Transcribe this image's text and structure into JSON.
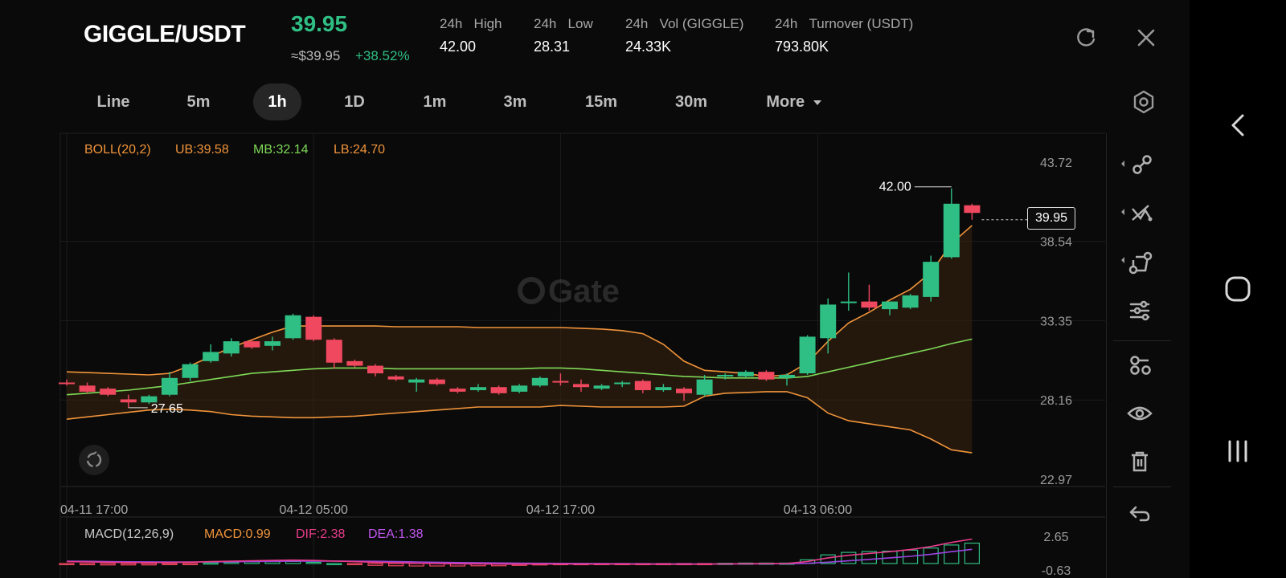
{
  "header": {
    "pair": "GIGGLE/USDT",
    "price": "39.95",
    "approx_usd": "≈$39.95",
    "change_pct": "+38.52%",
    "stats": [
      {
        "label_prefix": "24h",
        "label": "High",
        "value": "42.00"
      },
      {
        "label_prefix": "24h",
        "label": "Low",
        "value": "28.31"
      },
      {
        "label_prefix": "24h",
        "label": "Vol (GIGGLE)",
        "value": "24.33K"
      },
      {
        "label_prefix": "24h",
        "label": "Turnover (USDT)",
        "value": "793.80K"
      }
    ],
    "icons": [
      "refresh-icon",
      "close-icon"
    ]
  },
  "tabs": [
    {
      "label": "Line",
      "active": false
    },
    {
      "label": "5m",
      "active": false
    },
    {
      "label": "1h",
      "active": true
    },
    {
      "label": "1D",
      "active": false
    },
    {
      "label": "1m",
      "active": false
    },
    {
      "label": "3m",
      "active": false
    },
    {
      "label": "15m",
      "active": false
    },
    {
      "label": "30m",
      "active": false
    },
    {
      "label": "More",
      "active": false,
      "dropdown": true
    }
  ],
  "boll_legend": {
    "name": "BOLL(20,2)",
    "ub": "UB:39.58",
    "mb": "MB:32.14",
    "lb": "LB:24.70"
  },
  "macd_legend": {
    "name": "MACD(12,26,9)",
    "macd": "MACD:0.99",
    "dif": "DIF:2.38",
    "dea": "DEA:1.38"
  },
  "watermark": "Gate",
  "high_marker": "42.00",
  "low_marker": "27.65",
  "last_price_box": "39.95",
  "colors": {
    "up": "#2fbf84",
    "down": "#f0485f",
    "ub": "#f0943a",
    "mb": "#7ed957",
    "dif": "#e83c8c",
    "dea": "#9a45e0"
  },
  "sidebar_icons": [
    "trend-line-icon",
    "multi-line-icon",
    "shape-icon",
    "settings-sliders-icon",
    "indicators-icon",
    "eye-icon",
    "trash-icon",
    "undo-icon"
  ],
  "nav_icons": [
    "back-icon",
    "home-icon",
    "recents-icon"
  ],
  "chart_data": {
    "type": "candlestick",
    "price_axis_ticks": [
      "43.72",
      "38.54",
      "33.35",
      "28.16",
      "22.97"
    ],
    "price_range": [
      22.97,
      43.72
    ],
    "time_labels": [
      "04-11 17:00",
      "04-12 05:00",
      "04-12 17:00",
      "04-13 06:00"
    ],
    "time_label_candle_index": [
      0,
      12,
      24,
      36.5
    ],
    "candles": [
      {
        "o": 29.3,
        "h": 29.5,
        "l": 29.1,
        "c": 29.2
      },
      {
        "o": 29.1,
        "h": 29.3,
        "l": 28.6,
        "c": 28.7
      },
      {
        "o": 28.9,
        "h": 29.0,
        "l": 28.4,
        "c": 28.5
      },
      {
        "o": 28.2,
        "h": 28.5,
        "l": 27.65,
        "c": 28.0
      },
      {
        "o": 28.0,
        "h": 28.5,
        "l": 27.9,
        "c": 28.4
      },
      {
        "o": 28.5,
        "h": 30.0,
        "l": 28.4,
        "c": 29.6
      },
      {
        "o": 29.6,
        "h": 30.6,
        "l": 29.4,
        "c": 30.5
      },
      {
        "o": 30.7,
        "h": 31.8,
        "l": 30.6,
        "c": 31.3
      },
      {
        "o": 31.2,
        "h": 32.2,
        "l": 31.0,
        "c": 32.0
      },
      {
        "o": 32.0,
        "h": 32.1,
        "l": 31.5,
        "c": 31.6
      },
      {
        "o": 31.7,
        "h": 32.3,
        "l": 31.4,
        "c": 32.0
      },
      {
        "o": 32.2,
        "h": 33.8,
        "l": 32.1,
        "c": 33.7
      },
      {
        "o": 33.6,
        "h": 33.7,
        "l": 32.0,
        "c": 32.1
      },
      {
        "o": 32.1,
        "h": 32.2,
        "l": 30.2,
        "c": 30.6
      },
      {
        "o": 30.7,
        "h": 30.8,
        "l": 30.3,
        "c": 30.4
      },
      {
        "o": 30.4,
        "h": 30.5,
        "l": 29.7,
        "c": 29.9
      },
      {
        "o": 29.7,
        "h": 29.8,
        "l": 29.4,
        "c": 29.5
      },
      {
        "o": 29.3,
        "h": 29.6,
        "l": 28.7,
        "c": 29.5
      },
      {
        "o": 29.5,
        "h": 29.6,
        "l": 29.1,
        "c": 29.2
      },
      {
        "o": 28.9,
        "h": 29.0,
        "l": 28.6,
        "c": 28.7
      },
      {
        "o": 28.8,
        "h": 29.2,
        "l": 28.7,
        "c": 29.0
      },
      {
        "o": 29.0,
        "h": 29.1,
        "l": 28.5,
        "c": 28.6
      },
      {
        "o": 28.7,
        "h": 29.2,
        "l": 28.6,
        "c": 29.1
      },
      {
        "o": 29.1,
        "h": 29.7,
        "l": 29.0,
        "c": 29.6
      },
      {
        "o": 29.4,
        "h": 29.9,
        "l": 29.1,
        "c": 29.3
      },
      {
        "o": 29.2,
        "h": 29.5,
        "l": 28.7,
        "c": 29.0
      },
      {
        "o": 28.9,
        "h": 29.2,
        "l": 28.8,
        "c": 29.1
      },
      {
        "o": 29.2,
        "h": 29.4,
        "l": 29.0,
        "c": 29.3
      },
      {
        "o": 29.4,
        "h": 29.5,
        "l": 28.6,
        "c": 28.8
      },
      {
        "o": 28.8,
        "h": 29.2,
        "l": 28.7,
        "c": 29.0
      },
      {
        "o": 28.9,
        "h": 29.0,
        "l": 28.1,
        "c": 28.6
      },
      {
        "o": 28.5,
        "h": 29.8,
        "l": 28.4,
        "c": 29.5
      },
      {
        "o": 29.7,
        "h": 29.9,
        "l": 29.5,
        "c": 29.8
      },
      {
        "o": 29.7,
        "h": 30.1,
        "l": 29.6,
        "c": 30.0
      },
      {
        "o": 30.0,
        "h": 30.1,
        "l": 29.4,
        "c": 29.5
      },
      {
        "o": 29.6,
        "h": 29.9,
        "l": 29.1,
        "c": 29.8
      },
      {
        "o": 29.9,
        "h": 32.4,
        "l": 29.8,
        "c": 32.3
      },
      {
        "o": 32.2,
        "h": 34.8,
        "l": 31.2,
        "c": 34.4
      },
      {
        "o": 34.5,
        "h": 36.5,
        "l": 34.0,
        "c": 34.6
      },
      {
        "o": 34.6,
        "h": 35.7,
        "l": 34.0,
        "c": 34.2
      },
      {
        "o": 34.1,
        "h": 34.6,
        "l": 33.7,
        "c": 34.6
      },
      {
        "o": 34.2,
        "h": 35.1,
        "l": 34.1,
        "c": 35.0
      },
      {
        "o": 34.9,
        "h": 37.6,
        "l": 34.6,
        "c": 37.2
      },
      {
        "o": 37.5,
        "h": 42.0,
        "l": 37.4,
        "c": 41.0
      },
      {
        "o": 40.9,
        "h": 41.0,
        "l": 39.95,
        "c": 40.4
      }
    ],
    "boll_ub": [
      30.0,
      29.95,
      29.9,
      29.85,
      29.8,
      29.9,
      30.4,
      31.0,
      31.6,
      32.1,
      32.6,
      33.0,
      33.0,
      33.0,
      33.0,
      33.0,
      32.95,
      32.95,
      32.95,
      32.95,
      32.9,
      32.9,
      32.9,
      32.9,
      32.9,
      32.85,
      32.8,
      32.7,
      32.5,
      31.8,
      30.7,
      30.1,
      30.0,
      29.9,
      29.7,
      29.8,
      30.6,
      32.0,
      33.2,
      33.9,
      34.7,
      35.4,
      36.5,
      38.4,
      39.58
    ],
    "boll_mb": [
      28.5,
      28.6,
      28.7,
      28.8,
      28.95,
      29.1,
      29.3,
      29.5,
      29.7,
      29.9,
      30.0,
      30.1,
      30.2,
      30.25,
      30.25,
      30.25,
      30.2,
      30.2,
      30.2,
      30.2,
      30.2,
      30.2,
      30.2,
      30.25,
      30.25,
      30.2,
      30.1,
      30.0,
      29.9,
      29.8,
      29.7,
      29.65,
      29.6,
      29.6,
      29.6,
      29.6,
      29.7,
      30.0,
      30.3,
      30.6,
      30.9,
      31.2,
      31.5,
      31.85,
      32.14
    ],
    "boll_lb": [
      26.9,
      27.05,
      27.2,
      27.35,
      27.5,
      27.55,
      27.5,
      27.4,
      27.2,
      27.1,
      27.05,
      27.0,
      27.0,
      27.05,
      27.1,
      27.2,
      27.3,
      27.4,
      27.5,
      27.6,
      27.7,
      27.7,
      27.7,
      27.7,
      27.8,
      27.75,
      27.7,
      27.7,
      27.7,
      27.7,
      27.75,
      28.4,
      28.6,
      28.65,
      28.7,
      28.7,
      28.3,
      27.3,
      26.8,
      26.6,
      26.4,
      26.2,
      25.6,
      24.9,
      24.7
    ],
    "macd": {
      "axis_ticks": [
        "2.65",
        "-0.63"
      ],
      "range": [
        -0.63,
        2.65
      ],
      "dif": [
        0.18,
        0.15,
        0.12,
        0.1,
        0.09,
        0.1,
        0.13,
        0.18,
        0.23,
        0.27,
        0.3,
        0.33,
        0.3,
        0.24,
        0.18,
        0.12,
        0.07,
        0.03,
        0.0,
        -0.03,
        -0.04,
        -0.06,
        -0.06,
        -0.05,
        -0.05,
        -0.06,
        -0.06,
        -0.06,
        -0.07,
        -0.07,
        -0.08,
        -0.06,
        -0.04,
        -0.02,
        -0.01,
        0.0,
        0.2,
        0.55,
        0.8,
        0.98,
        1.15,
        1.35,
        1.65,
        2.05,
        2.38
      ],
      "dea": [
        0.22,
        0.21,
        0.19,
        0.17,
        0.16,
        0.15,
        0.15,
        0.15,
        0.17,
        0.19,
        0.21,
        0.23,
        0.24,
        0.24,
        0.23,
        0.21,
        0.18,
        0.15,
        0.12,
        0.09,
        0.07,
        0.05,
        0.03,
        0.02,
        0.01,
        0.0,
        -0.01,
        -0.02,
        -0.03,
        -0.04,
        -0.04,
        -0.05,
        -0.05,
        -0.04,
        -0.03,
        -0.02,
        0.02,
        0.13,
        0.26,
        0.4,
        0.55,
        0.7,
        0.9,
        1.15,
        1.38
      ],
      "hist": [
        -0.08,
        -0.12,
        -0.14,
        -0.14,
        -0.14,
        -0.1,
        -0.04,
        0.06,
        0.12,
        0.16,
        0.18,
        0.2,
        0.12,
        0.0,
        -0.1,
        -0.18,
        -0.22,
        -0.24,
        -0.24,
        -0.24,
        -0.22,
        -0.22,
        -0.18,
        -0.14,
        -0.12,
        -0.12,
        -0.1,
        -0.08,
        -0.08,
        -0.06,
        -0.08,
        -0.02,
        0.02,
        0.04,
        0.04,
        0.04,
        0.36,
        0.84,
        1.08,
        1.16,
        1.2,
        1.3,
        1.5,
        1.8,
        1.98
      ]
    }
  }
}
